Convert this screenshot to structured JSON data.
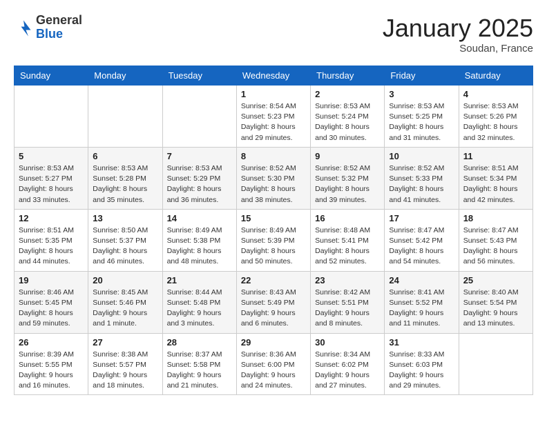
{
  "header": {
    "logo_general": "General",
    "logo_blue": "Blue",
    "month": "January 2025",
    "location": "Soudan, France"
  },
  "days_of_week": [
    "Sunday",
    "Monday",
    "Tuesday",
    "Wednesday",
    "Thursday",
    "Friday",
    "Saturday"
  ],
  "weeks": [
    [
      {
        "day": "",
        "info": ""
      },
      {
        "day": "",
        "info": ""
      },
      {
        "day": "",
        "info": ""
      },
      {
        "day": "1",
        "info": "Sunrise: 8:54 AM\nSunset: 5:23 PM\nDaylight: 8 hours and 29 minutes."
      },
      {
        "day": "2",
        "info": "Sunrise: 8:53 AM\nSunset: 5:24 PM\nDaylight: 8 hours and 30 minutes."
      },
      {
        "day": "3",
        "info": "Sunrise: 8:53 AM\nSunset: 5:25 PM\nDaylight: 8 hours and 31 minutes."
      },
      {
        "day": "4",
        "info": "Sunrise: 8:53 AM\nSunset: 5:26 PM\nDaylight: 8 hours and 32 minutes."
      }
    ],
    [
      {
        "day": "5",
        "info": "Sunrise: 8:53 AM\nSunset: 5:27 PM\nDaylight: 8 hours and 33 minutes."
      },
      {
        "day": "6",
        "info": "Sunrise: 8:53 AM\nSunset: 5:28 PM\nDaylight: 8 hours and 35 minutes."
      },
      {
        "day": "7",
        "info": "Sunrise: 8:53 AM\nSunset: 5:29 PM\nDaylight: 8 hours and 36 minutes."
      },
      {
        "day": "8",
        "info": "Sunrise: 8:52 AM\nSunset: 5:30 PM\nDaylight: 8 hours and 38 minutes."
      },
      {
        "day": "9",
        "info": "Sunrise: 8:52 AM\nSunset: 5:32 PM\nDaylight: 8 hours and 39 minutes."
      },
      {
        "day": "10",
        "info": "Sunrise: 8:52 AM\nSunset: 5:33 PM\nDaylight: 8 hours and 41 minutes."
      },
      {
        "day": "11",
        "info": "Sunrise: 8:51 AM\nSunset: 5:34 PM\nDaylight: 8 hours and 42 minutes."
      }
    ],
    [
      {
        "day": "12",
        "info": "Sunrise: 8:51 AM\nSunset: 5:35 PM\nDaylight: 8 hours and 44 minutes."
      },
      {
        "day": "13",
        "info": "Sunrise: 8:50 AM\nSunset: 5:37 PM\nDaylight: 8 hours and 46 minutes."
      },
      {
        "day": "14",
        "info": "Sunrise: 8:49 AM\nSunset: 5:38 PM\nDaylight: 8 hours and 48 minutes."
      },
      {
        "day": "15",
        "info": "Sunrise: 8:49 AM\nSunset: 5:39 PM\nDaylight: 8 hours and 50 minutes."
      },
      {
        "day": "16",
        "info": "Sunrise: 8:48 AM\nSunset: 5:41 PM\nDaylight: 8 hours and 52 minutes."
      },
      {
        "day": "17",
        "info": "Sunrise: 8:47 AM\nSunset: 5:42 PM\nDaylight: 8 hours and 54 minutes."
      },
      {
        "day": "18",
        "info": "Sunrise: 8:47 AM\nSunset: 5:43 PM\nDaylight: 8 hours and 56 minutes."
      }
    ],
    [
      {
        "day": "19",
        "info": "Sunrise: 8:46 AM\nSunset: 5:45 PM\nDaylight: 8 hours and 59 minutes."
      },
      {
        "day": "20",
        "info": "Sunrise: 8:45 AM\nSunset: 5:46 PM\nDaylight: 9 hours and 1 minute."
      },
      {
        "day": "21",
        "info": "Sunrise: 8:44 AM\nSunset: 5:48 PM\nDaylight: 9 hours and 3 minutes."
      },
      {
        "day": "22",
        "info": "Sunrise: 8:43 AM\nSunset: 5:49 PM\nDaylight: 9 hours and 6 minutes."
      },
      {
        "day": "23",
        "info": "Sunrise: 8:42 AM\nSunset: 5:51 PM\nDaylight: 9 hours and 8 minutes."
      },
      {
        "day": "24",
        "info": "Sunrise: 8:41 AM\nSunset: 5:52 PM\nDaylight: 9 hours and 11 minutes."
      },
      {
        "day": "25",
        "info": "Sunrise: 8:40 AM\nSunset: 5:54 PM\nDaylight: 9 hours and 13 minutes."
      }
    ],
    [
      {
        "day": "26",
        "info": "Sunrise: 8:39 AM\nSunset: 5:55 PM\nDaylight: 9 hours and 16 minutes."
      },
      {
        "day": "27",
        "info": "Sunrise: 8:38 AM\nSunset: 5:57 PM\nDaylight: 9 hours and 18 minutes."
      },
      {
        "day": "28",
        "info": "Sunrise: 8:37 AM\nSunset: 5:58 PM\nDaylight: 9 hours and 21 minutes."
      },
      {
        "day": "29",
        "info": "Sunrise: 8:36 AM\nSunset: 6:00 PM\nDaylight: 9 hours and 24 minutes."
      },
      {
        "day": "30",
        "info": "Sunrise: 8:34 AM\nSunset: 6:02 PM\nDaylight: 9 hours and 27 minutes."
      },
      {
        "day": "31",
        "info": "Sunrise: 8:33 AM\nSunset: 6:03 PM\nDaylight: 9 hours and 29 minutes."
      },
      {
        "day": "",
        "info": ""
      }
    ]
  ]
}
